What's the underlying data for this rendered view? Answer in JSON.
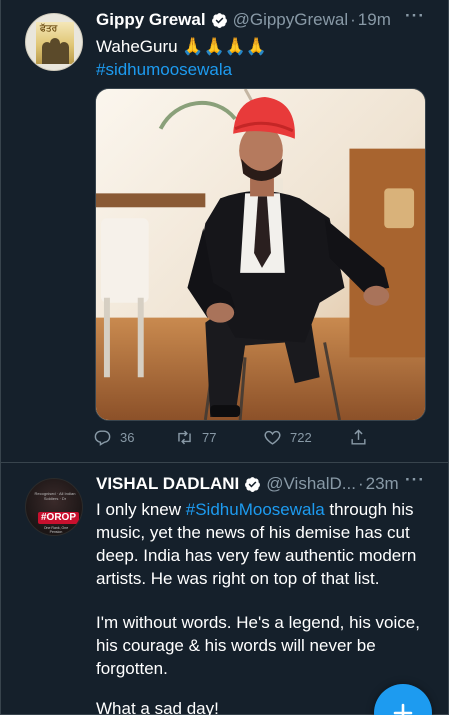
{
  "tweets": [
    {
      "name": "Gippy Grewal",
      "handle": "@GippyGrewal",
      "time": "19m",
      "text_line1": "WaheGuru 🙏🙏🙏🙏",
      "hashtag": "#sidhumoosewala",
      "avatar_poster_title": "ਫੱਤਰ",
      "replies": "36",
      "retweets": "77",
      "likes": "722"
    },
    {
      "name": "VISHAL DADLANI",
      "handle": "@VishalD...",
      "time": "23m",
      "p1": {
        "before": "I only knew ",
        "hashtag": "#SidhuMoosewala",
        "after_line1": " through his",
        "line2": "music, yet the news of his demise has cut",
        "line3": "deep. India has very few authentic modern",
        "line4": "artists. He was right on top of that list."
      },
      "p2": {
        "line1": "I'm without words. He's a legend, his voice,",
        "line2": "his courage & his words will never be",
        "line3": "forgotten."
      },
      "p3": "What a sad day!",
      "avatar_badge": "#OROP",
      "avatar_small_top": "Recognised · All Indian Soldiers · Dr",
      "avatar_small_bottom": "One Rank, One Pension"
    }
  ],
  "more_label": "···",
  "dot": "·",
  "colors": {
    "background": "#15202b",
    "accent": "#1d9bf0",
    "secondary_text": "#8899a6",
    "divider": "#38444d"
  },
  "icons": {
    "verified": "verified-badge-icon",
    "reply": "reply-icon",
    "retweet": "retweet-icon",
    "like": "heart-icon",
    "share": "share-icon",
    "compose": "plus-icon"
  }
}
